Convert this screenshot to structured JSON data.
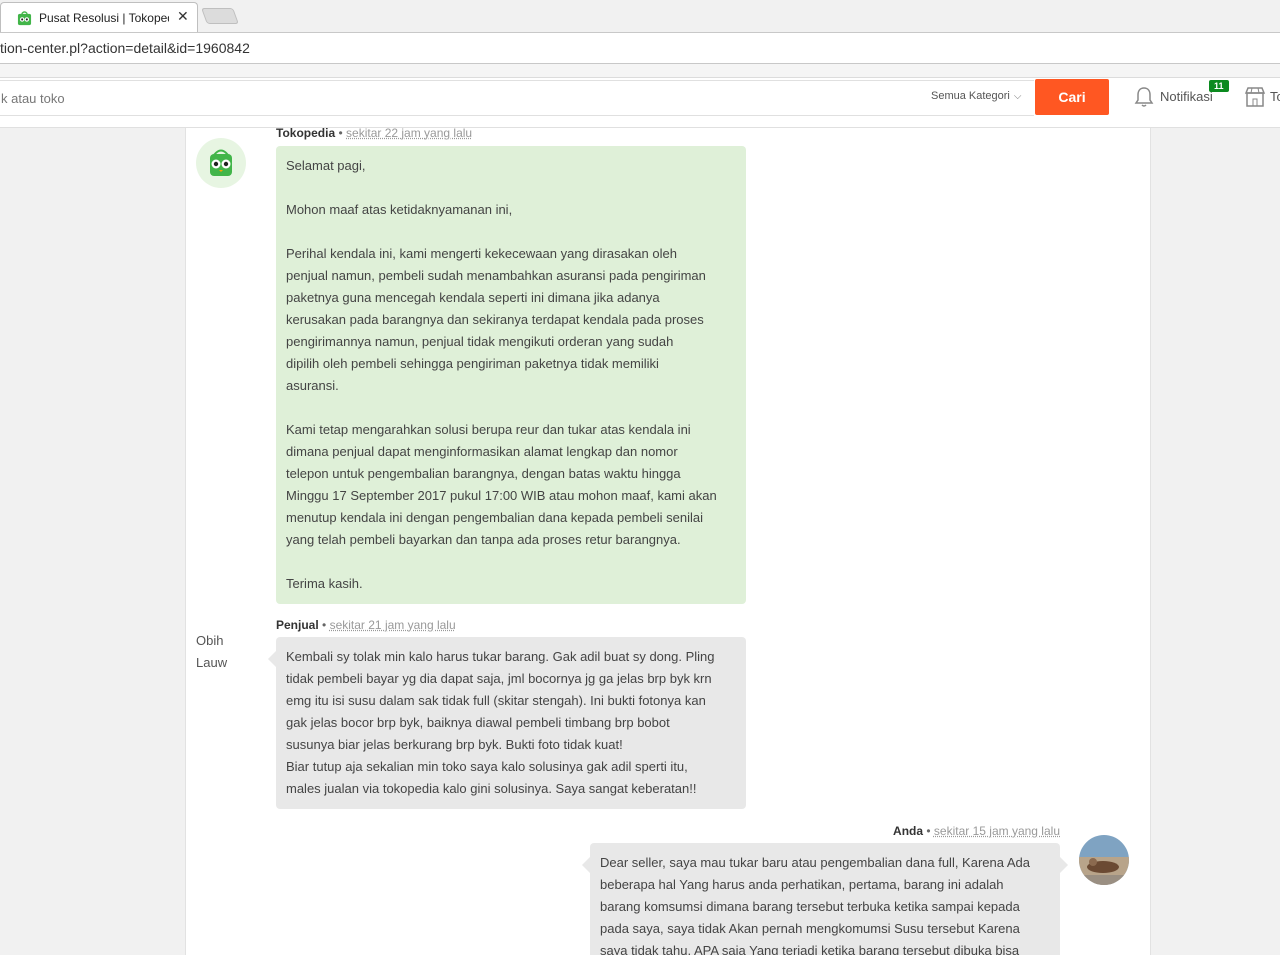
{
  "browser": {
    "tab_title": "Pusat Resolusi | Tokopedia",
    "url": "tion-center.pl?action=detail&id=1960842"
  },
  "header": {
    "search_placeholder": "k atau toko",
    "category": "Semua Kategori",
    "search_button": "Cari",
    "notif_label": "Notifikasi",
    "notif_count": "11",
    "store_label": "To",
    "accent_color": "#ff5722"
  },
  "messages": [
    {
      "author": "Tokopedia",
      "time": "sekitar 22 jam yang lalu",
      "lines": [
        "Selamat pagi,",
        "",
        "Mohon maaf atas ketidaknyamanan ini,",
        "",
        "Perihal kendala ini, kami mengerti kekecewaan yang dirasakan oleh",
        "penjual namun, pembeli sudah menambahkan asuransi pada pengiriman",
        "paketnya guna mencegah kendala seperti ini dimana jika adanya",
        "kerusakan pada barangnya dan sekiranya terdapat kendala pada proses",
        "pengirimannya namun, penjual tidak mengikuti orderan yang sudah",
        "dipilih oleh pembeli sehingga pengiriman paketnya tidak memiliki",
        "asuransi.",
        "",
        "Kami tetap mengarahkan solusi berupa reur dan tukar atas kendala ini",
        "dimana penjual dapat menginformasikan alamat lengkap dan nomor",
        "telepon untuk pengembalian barangnya, dengan batas waktu hingga",
        "Minggu 17 September 2017 pukul 17:00 WIB atau mohon maaf, kami akan",
        "menutup kendala ini dengan pengembalian dana kepada pembeli senilai",
        "yang telah pembeli bayarkan dan tanpa ada proses retur barangnya.",
        "",
        "Terima kasih."
      ]
    },
    {
      "author": "Penjual",
      "time": "sekitar 21 jam yang lalu",
      "sender_name": "Obih Lauw",
      "lines": [
        "Kembali sy tolak min kalo harus tukar barang. Gak adil buat sy dong. Pling",
        "tidak pembeli bayar yg dia dapat saja, jml bocornya jg ga jelas brp byk krn",
        "emg itu isi susu dalam sak tidak full (skitar stengah). Ini bukti fotonya kan",
        "gak jelas bocor brp byk, baiknya diawal pembeli timbang brp bobot",
        "susunya biar jelas berkurang brp byk. Bukti foto tidak kuat!",
        "Biar tutup aja sekalian min toko saya kalo solusinya gak adil sperti itu,",
        "males jualan via tokopedia kalo gini solusinya. Saya sangat keberatan!!"
      ]
    },
    {
      "author": "Anda",
      "time": "sekitar 15 jam yang lalu",
      "lines": [
        "Dear seller, saya mau tukar baru atau pengembalian dana full, Karena Ada",
        "beberapa hal Yang harus anda perhatikan, pertama, barang ini adalah",
        "barang komsumsi dimana barang tersebut terbuka ketika sampai kepada",
        "pada saya, saya tidak Akan pernah mengkomumsi Susu tersebut Karena",
        "saya tidak tahu, APA saja Yang terjadi ketika barang tersebut dibuka bisa"
      ]
    }
  ]
}
